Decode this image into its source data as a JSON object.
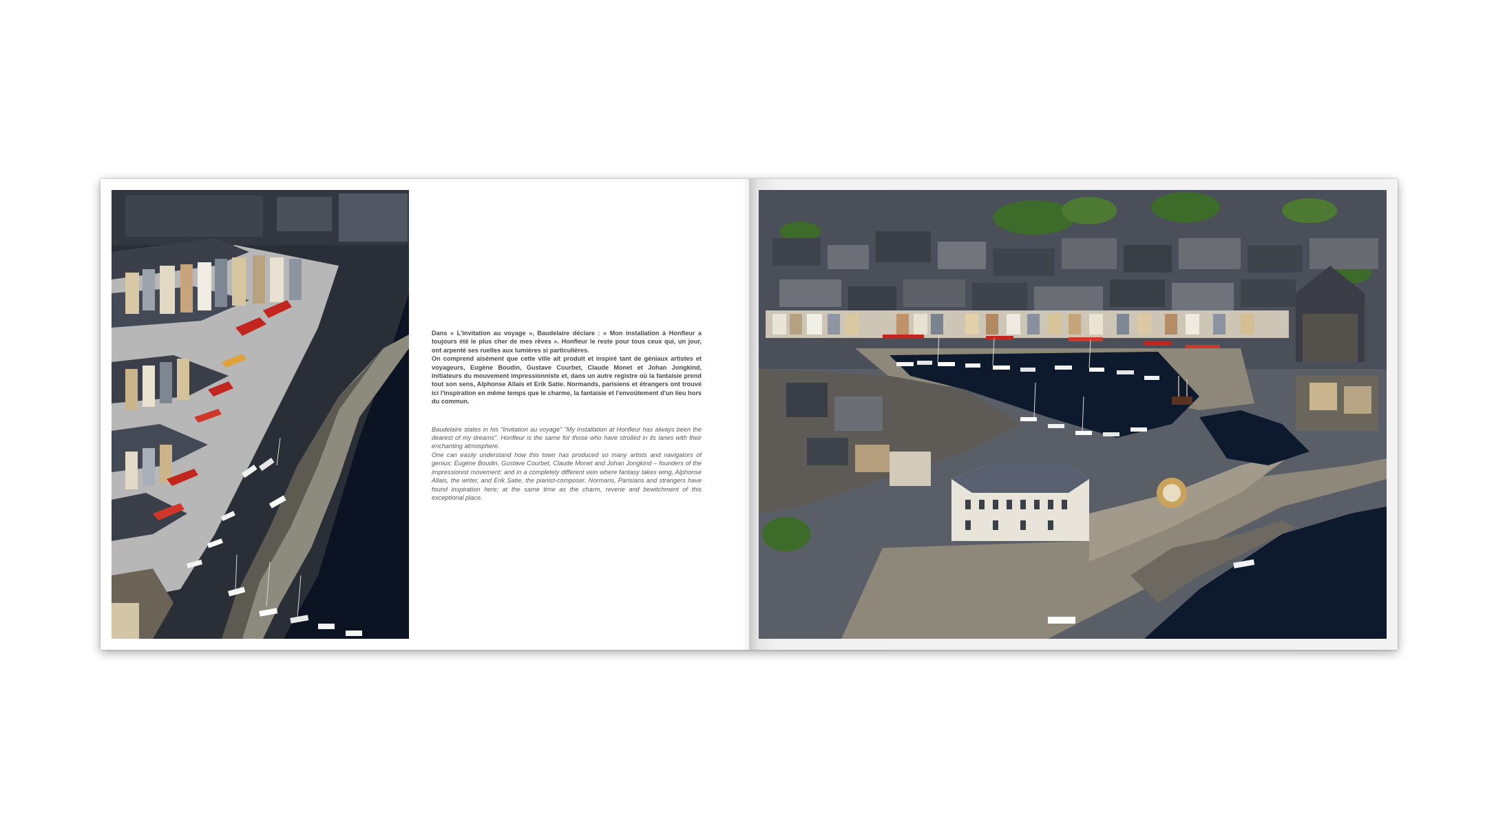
{
  "spread": {
    "left_page": {
      "photo": {
        "name": "Honfleur harbour quay, aerial view",
        "colors": {
          "water": "#0c1423",
          "quay": "#8d8a7e",
          "awning_red": "#c2261e",
          "facades": "#b7b7b7",
          "roofs": "#3a3f49"
        }
      },
      "text": {
        "fr_paragraph_1": "Dans « L'invitation au voyage », Baudelaire déclare : « Mon installation à Honfleur a toujours été le plus cher de mes rêves ». Honfleur le reste pour tous ceux qui, un jour, ont arpenté ses ruelles aux lumières si particulières.",
        "fr_paragraph_2": "On comprend aisément que cette ville ait produit et inspiré tant de géniaux artistes et voyageurs, Eugène Boudin, Gustave Courbet, Claude Monet et Johan Jongkind, initiateurs du mouvement impressionniste et, dans un autre registre où la fantaisie prend tout son sens, Alphonse Allais et Erik Satie. Normands, parisiens et étrangers ont trouvé ici l'inspiration en même temps que le charme, la fantaisie et l'envoûtement d'un lieu hors du commun.",
        "en_paragraph_1": "Baudelaire states in his \"Invitation au voyage\" \"My installation at Honfleur has always been the dearest of my dreams\". Honfleur is the same for those who have strolled in its lanes with their enchanting atmosphere.",
        "en_paragraph_2": "One can easily understand how this town has produced so many artists and navigators of genius: Eugène Boudin, Gustave Courbet, Claude Monet and Johan Jongkind – founders of the impressionist movement; and in a completely different vein where fantasy takes wing, Alphonse Allais, the writer, and Erik Satie, the pianist-composer. Normans, Parisians and strangers have found inspiration here; at the same time as the charm, reverie and bewitchment of this exceptional place."
      }
    },
    "right_page": {
      "photo": {
        "name": "Honfleur Vieux Bassin panorama, aerial view",
        "colors": {
          "water": "#0d1a2e",
          "roofs": "#4a4f5a",
          "trees": "#3d6b2a",
          "lieutenance": "#e8e4da",
          "plaza": "#8e887a"
        }
      }
    }
  }
}
